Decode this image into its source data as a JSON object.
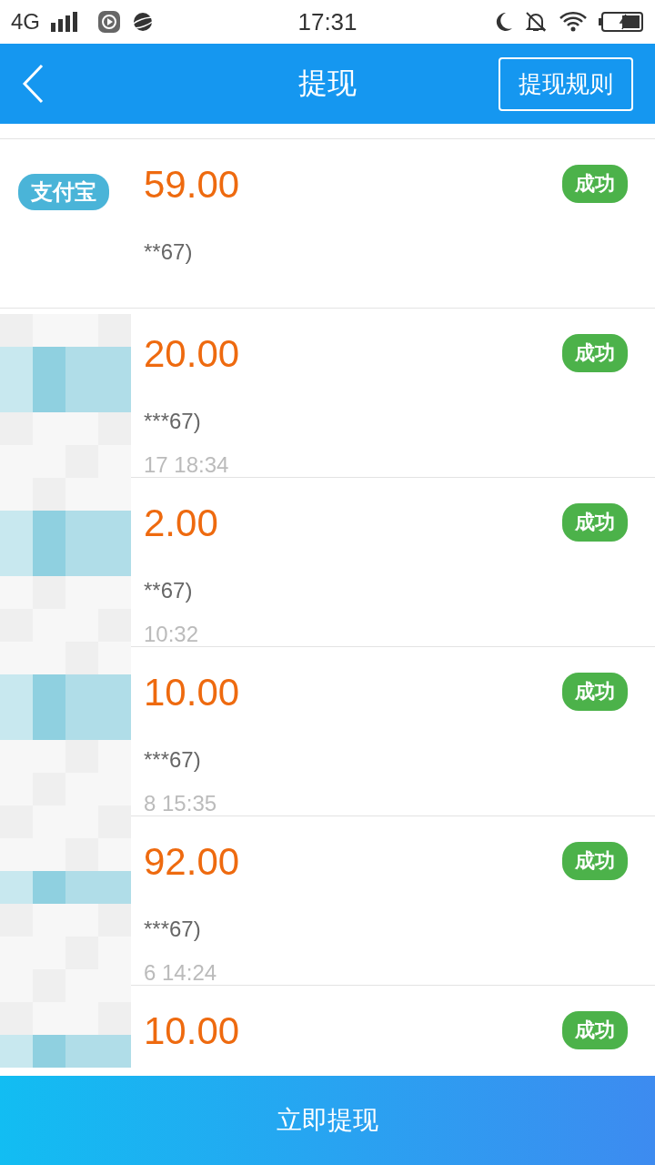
{
  "status_bar": {
    "network": "4G",
    "time": "17:31"
  },
  "header": {
    "title": "提现",
    "action": "提现规则"
  },
  "records": [
    {
      "badge": "支付宝",
      "amount": "59.00",
      "account": "**67)",
      "status": "成功"
    },
    {
      "amount": "20.00",
      "account": "***67)",
      "time": "17 18:34",
      "status": "成功"
    },
    {
      "amount": "2.00",
      "account": "**67)",
      "time": "10:32",
      "status": "成功"
    },
    {
      "amount": "10.00",
      "account": "***67)",
      "time": "8 15:35",
      "status": "成功"
    },
    {
      "amount": "92.00",
      "account": "***67)",
      "time": "6 14:24",
      "status": "成功"
    },
    {
      "amount": "10.00",
      "status": "成功"
    }
  ],
  "bottom_button": "立即提现"
}
